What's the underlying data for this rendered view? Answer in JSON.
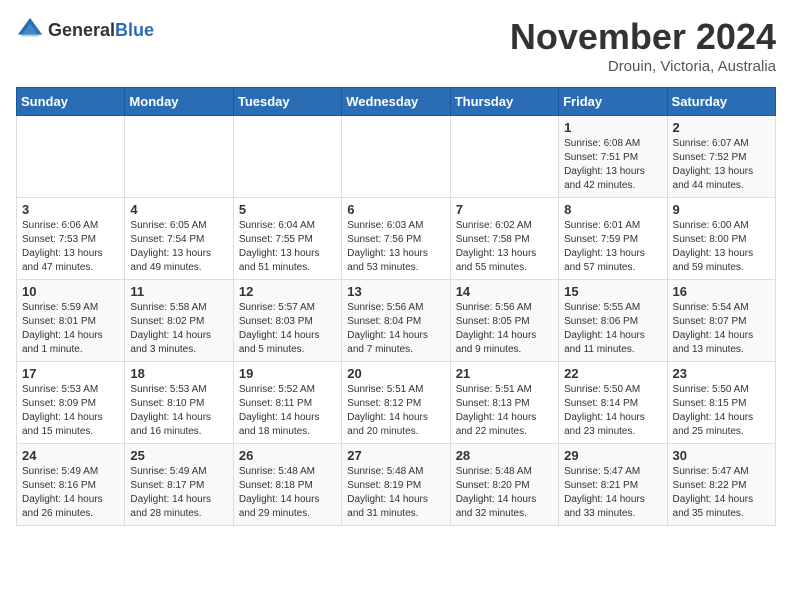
{
  "header": {
    "logo_general": "General",
    "logo_blue": "Blue",
    "month": "November 2024",
    "location": "Drouin, Victoria, Australia"
  },
  "days_of_week": [
    "Sunday",
    "Monday",
    "Tuesday",
    "Wednesday",
    "Thursday",
    "Friday",
    "Saturday"
  ],
  "weeks": [
    [
      {
        "day": "",
        "info": ""
      },
      {
        "day": "",
        "info": ""
      },
      {
        "day": "",
        "info": ""
      },
      {
        "day": "",
        "info": ""
      },
      {
        "day": "",
        "info": ""
      },
      {
        "day": "1",
        "info": "Sunrise: 6:08 AM\nSunset: 7:51 PM\nDaylight: 13 hours\nand 42 minutes."
      },
      {
        "day": "2",
        "info": "Sunrise: 6:07 AM\nSunset: 7:52 PM\nDaylight: 13 hours\nand 44 minutes."
      }
    ],
    [
      {
        "day": "3",
        "info": "Sunrise: 6:06 AM\nSunset: 7:53 PM\nDaylight: 13 hours\nand 47 minutes."
      },
      {
        "day": "4",
        "info": "Sunrise: 6:05 AM\nSunset: 7:54 PM\nDaylight: 13 hours\nand 49 minutes."
      },
      {
        "day": "5",
        "info": "Sunrise: 6:04 AM\nSunset: 7:55 PM\nDaylight: 13 hours\nand 51 minutes."
      },
      {
        "day": "6",
        "info": "Sunrise: 6:03 AM\nSunset: 7:56 PM\nDaylight: 13 hours\nand 53 minutes."
      },
      {
        "day": "7",
        "info": "Sunrise: 6:02 AM\nSunset: 7:58 PM\nDaylight: 13 hours\nand 55 minutes."
      },
      {
        "day": "8",
        "info": "Sunrise: 6:01 AM\nSunset: 7:59 PM\nDaylight: 13 hours\nand 57 minutes."
      },
      {
        "day": "9",
        "info": "Sunrise: 6:00 AM\nSunset: 8:00 PM\nDaylight: 13 hours\nand 59 minutes."
      }
    ],
    [
      {
        "day": "10",
        "info": "Sunrise: 5:59 AM\nSunset: 8:01 PM\nDaylight: 14 hours\nand 1 minute."
      },
      {
        "day": "11",
        "info": "Sunrise: 5:58 AM\nSunset: 8:02 PM\nDaylight: 14 hours\nand 3 minutes."
      },
      {
        "day": "12",
        "info": "Sunrise: 5:57 AM\nSunset: 8:03 PM\nDaylight: 14 hours\nand 5 minutes."
      },
      {
        "day": "13",
        "info": "Sunrise: 5:56 AM\nSunset: 8:04 PM\nDaylight: 14 hours\nand 7 minutes."
      },
      {
        "day": "14",
        "info": "Sunrise: 5:56 AM\nSunset: 8:05 PM\nDaylight: 14 hours\nand 9 minutes."
      },
      {
        "day": "15",
        "info": "Sunrise: 5:55 AM\nSunset: 8:06 PM\nDaylight: 14 hours\nand 11 minutes."
      },
      {
        "day": "16",
        "info": "Sunrise: 5:54 AM\nSunset: 8:07 PM\nDaylight: 14 hours\nand 13 minutes."
      }
    ],
    [
      {
        "day": "17",
        "info": "Sunrise: 5:53 AM\nSunset: 8:09 PM\nDaylight: 14 hours\nand 15 minutes."
      },
      {
        "day": "18",
        "info": "Sunrise: 5:53 AM\nSunset: 8:10 PM\nDaylight: 14 hours\nand 16 minutes."
      },
      {
        "day": "19",
        "info": "Sunrise: 5:52 AM\nSunset: 8:11 PM\nDaylight: 14 hours\nand 18 minutes."
      },
      {
        "day": "20",
        "info": "Sunrise: 5:51 AM\nSunset: 8:12 PM\nDaylight: 14 hours\nand 20 minutes."
      },
      {
        "day": "21",
        "info": "Sunrise: 5:51 AM\nSunset: 8:13 PM\nDaylight: 14 hours\nand 22 minutes."
      },
      {
        "day": "22",
        "info": "Sunrise: 5:50 AM\nSunset: 8:14 PM\nDaylight: 14 hours\nand 23 minutes."
      },
      {
        "day": "23",
        "info": "Sunrise: 5:50 AM\nSunset: 8:15 PM\nDaylight: 14 hours\nand 25 minutes."
      }
    ],
    [
      {
        "day": "24",
        "info": "Sunrise: 5:49 AM\nSunset: 8:16 PM\nDaylight: 14 hours\nand 26 minutes."
      },
      {
        "day": "25",
        "info": "Sunrise: 5:49 AM\nSunset: 8:17 PM\nDaylight: 14 hours\nand 28 minutes."
      },
      {
        "day": "26",
        "info": "Sunrise: 5:48 AM\nSunset: 8:18 PM\nDaylight: 14 hours\nand 29 minutes."
      },
      {
        "day": "27",
        "info": "Sunrise: 5:48 AM\nSunset: 8:19 PM\nDaylight: 14 hours\nand 31 minutes."
      },
      {
        "day": "28",
        "info": "Sunrise: 5:48 AM\nSunset: 8:20 PM\nDaylight: 14 hours\nand 32 minutes."
      },
      {
        "day": "29",
        "info": "Sunrise: 5:47 AM\nSunset: 8:21 PM\nDaylight: 14 hours\nand 33 minutes."
      },
      {
        "day": "30",
        "info": "Sunrise: 5:47 AM\nSunset: 8:22 PM\nDaylight: 14 hours\nand 35 minutes."
      }
    ]
  ]
}
